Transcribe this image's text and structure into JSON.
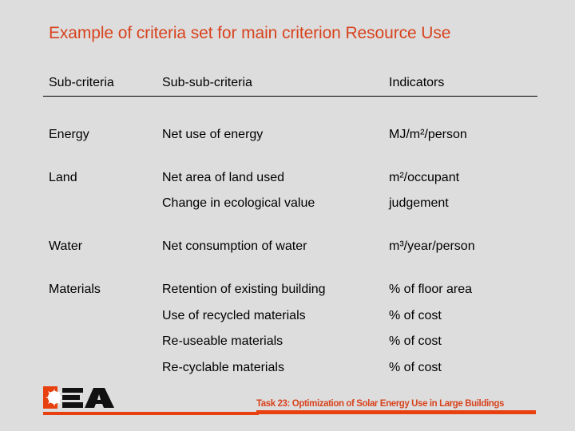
{
  "slide": {
    "title": "Example of criteria set for main criterion Resource Use"
  },
  "table": {
    "headers": [
      "Sub-criteria",
      "Sub-sub-criteria",
      "Indicators"
    ],
    "rows": [
      {
        "sub_criteria": "Energy",
        "sub_sub_criteria": "Net use of energy",
        "indicator": "MJ/m²/person"
      },
      {
        "sub_criteria": "Land",
        "sub_sub_criteria": "Net area of land used",
        "indicator": "m²/occupant"
      },
      {
        "sub_criteria": "",
        "sub_sub_criteria": "Change in ecological value",
        "indicator": "judgement"
      },
      {
        "sub_criteria": "Water",
        "sub_sub_criteria": "Net consumption of water",
        "indicator": "m³/year/person"
      },
      {
        "sub_criteria": "Materials",
        "sub_sub_criteria": "Retention of existing building",
        "indicator": "% of floor area"
      },
      {
        "sub_criteria": "",
        "sub_sub_criteria": "Use of recycled materials",
        "indicator": "% of cost"
      },
      {
        "sub_criteria": "",
        "sub_sub_criteria": "Re-useable materials",
        "indicator": "% of cost"
      },
      {
        "sub_criteria": "",
        "sub_sub_criteria": "Re-cyclable materials",
        "indicator": "% of cost"
      }
    ]
  },
  "footer": {
    "logo": "iea-logo",
    "text": "Task 23: Optimization of Solar Energy Use in Large Buildings"
  },
  "colors": {
    "accent": "#d8431e",
    "background": "#dddddd"
  }
}
